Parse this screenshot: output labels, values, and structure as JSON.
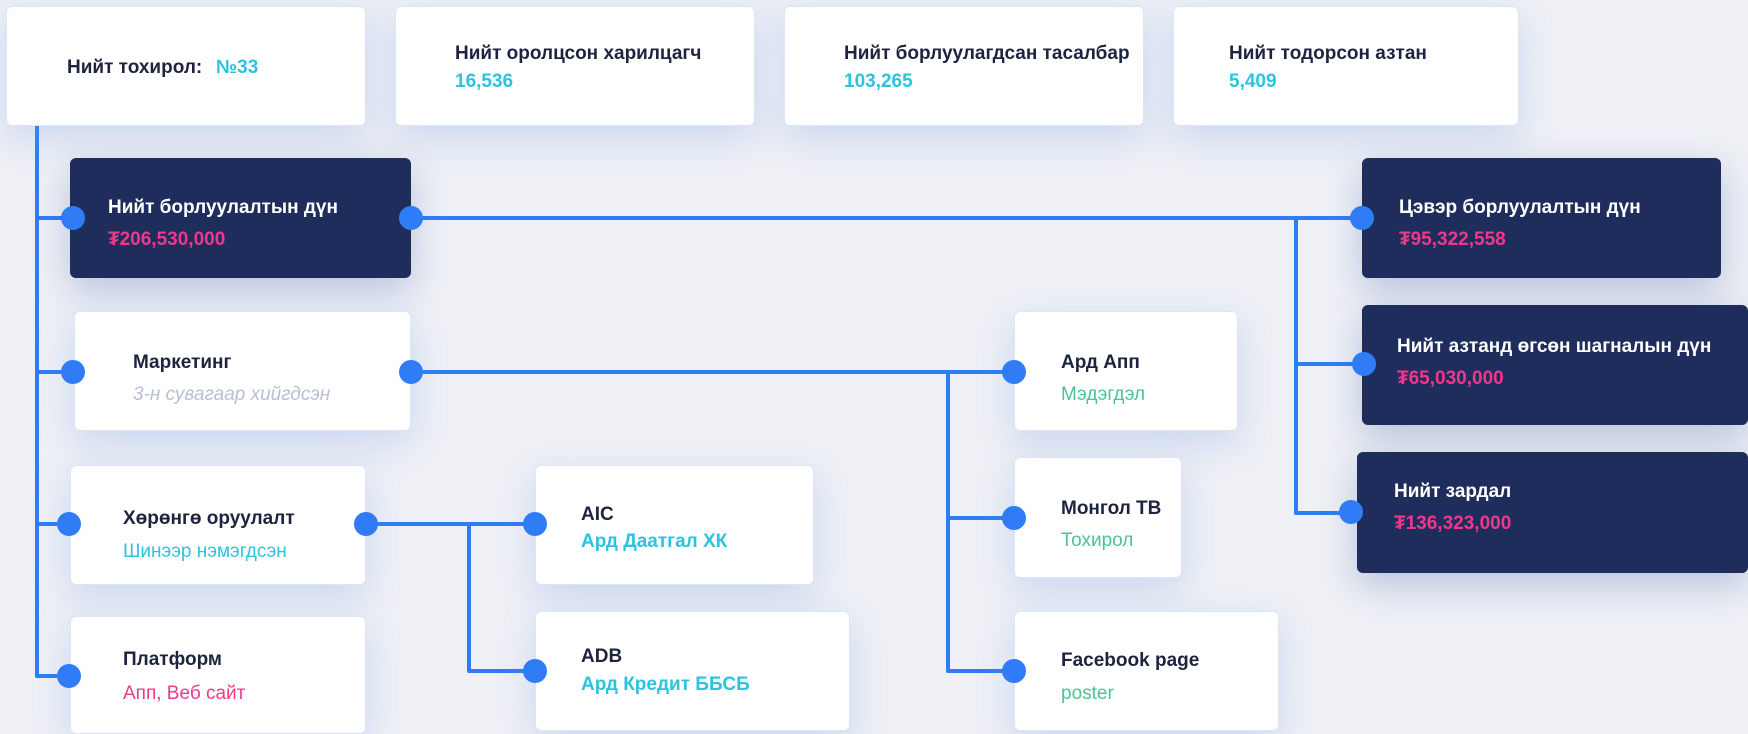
{
  "colors": {
    "line": "#2f7cf6",
    "dark_card": "#1f2d5c",
    "accent_cyan": "#2cc3df",
    "accent_pink": "#f0378a",
    "accent_green": "#4cc48f",
    "muted": "#b6bfd4"
  },
  "summary": {
    "total_match": {
      "label": "Нийт тохирол:",
      "value": "№33"
    },
    "participants": {
      "label": "Нийт оролцсон харилцагч",
      "value": "16,536"
    },
    "tickets_sold": {
      "label": "Нийт борлуулагдсан тасалбар",
      "value": "103,265"
    },
    "winners": {
      "label": "Нийт тодорсон азтан",
      "value": "5,409"
    }
  },
  "sales": {
    "label": "Нийт борлуулалтын дүн",
    "value": "₮206,530,000"
  },
  "marketing": {
    "label": "Маркетинг",
    "sub": "3-н сувагаар хийгдсэн"
  },
  "assets": {
    "label": "Хөрөнгө оруулалт",
    "sub": "Шинээр нэмэгдсэн"
  },
  "platform": {
    "label": "Платформ",
    "sub": "Апп, Веб сайт"
  },
  "aic": {
    "label": "AIC",
    "sub": "Ард Даатгал ХК"
  },
  "adb": {
    "label": "ADB",
    "sub": "Ард Кредит ББСБ"
  },
  "ard_app": {
    "label": "Ард Апп",
    "sub": "Мэдэгдэл"
  },
  "mongol_tv": {
    "label": "Монгол ТВ",
    "sub": "Тохирол"
  },
  "facebook": {
    "label": "Facebook page",
    "sub": "poster"
  },
  "net_sales": {
    "label": "Цэвэр борлуулалтын дүн",
    "value": "₮95,322,558"
  },
  "prizes": {
    "label": "Нийт азтанд өгсөн шагналын дүн",
    "value": "₮65,030,000"
  },
  "expenses": {
    "label": "Нийт зардал",
    "value": "₮136,323,000"
  }
}
